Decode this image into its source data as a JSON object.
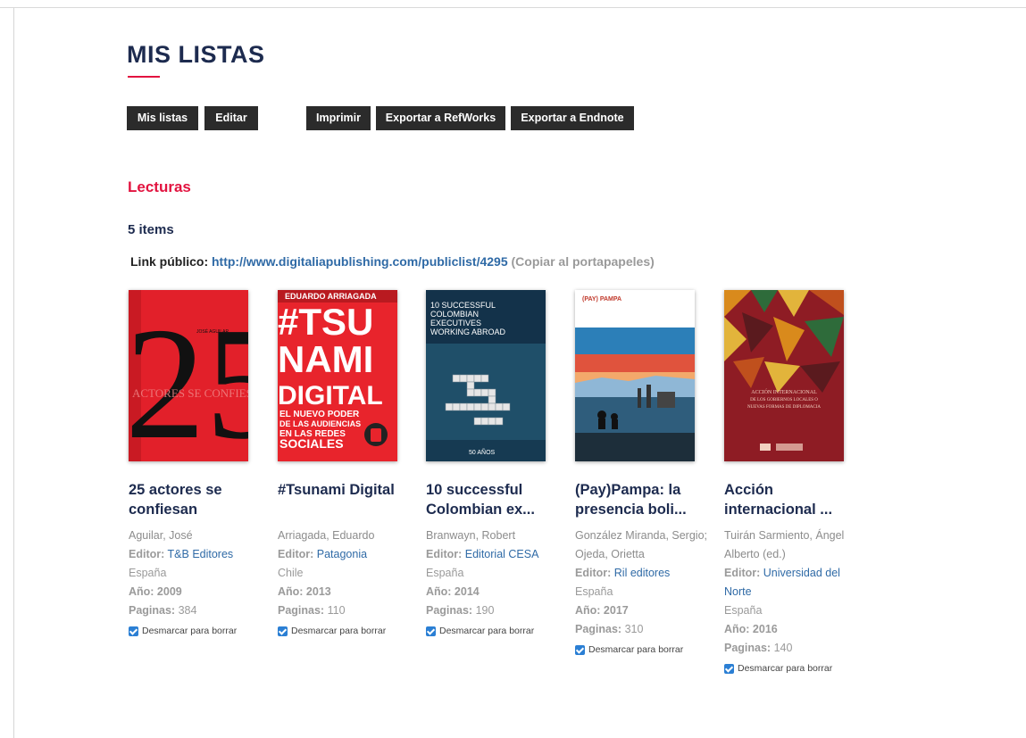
{
  "page": {
    "title": "MIS LISTAS",
    "list_name": "Lecturas",
    "item_count": "5 items",
    "public_link_label": "Link público:",
    "public_link_url": "http://www.digitaliapublishing.com/publiclist/4295",
    "copy_label": "(Copiar al portapapeles)"
  },
  "toolbar": {
    "mis_listas": "Mis listas",
    "editar": "Editar",
    "imprimir": "Imprimir",
    "refworks": "Exportar a RefWorks",
    "endnote": "Exportar a Endnote"
  },
  "labels": {
    "editor": "Editor:",
    "pages": "Paginas:",
    "uncheck": "Desmarcar para borrar"
  },
  "books": [
    {
      "title": "25 actores se confiesan",
      "author": "Aguilar, José",
      "editor": "T&B Editores",
      "country": "España",
      "year": "Año: 2009",
      "pages": "384",
      "cover": {
        "number": "25",
        "author_text": "JOSÉ AGUILAR",
        "subtitle": "ACTORES SE CONFIESAN"
      }
    },
    {
      "title": "#Tsunami Digital",
      "author": "Arriagada, Eduardo",
      "editor": "Patagonia",
      "country": "Chile",
      "year": "Año: 2013",
      "pages": "110",
      "cover": {
        "author_text": "EDUARDO ARRIAGADA",
        "line1": "#TSU",
        "line2": "NAMI",
        "line3": "DIGITAL",
        "sub1": "EL NUEVO PODER",
        "sub2": "DE LAS AUDIENCIAS",
        "sub3": "EN LAS REDES",
        "sub4": "SOCIALES"
      }
    },
    {
      "title": "10 successful Colombian ex...",
      "author": "Branwayn, Robert",
      "editor": "Editorial CESA",
      "country": "España",
      "year": "Año: 2014",
      "pages": "190",
      "cover": {
        "line1": "10 SUCCESSFUL",
        "line2": "COLOMBIAN",
        "line3": "EXECUTIVES",
        "line4": "WORKING ABROAD",
        "years": "50 AÑOS"
      }
    },
    {
      "title": "(Pay)Pampa: la presencia boli...",
      "author": "González Miranda, Sergio; Ojeda, Orietta",
      "editor": "Ril editores",
      "country": "España",
      "year": "Año: 2017",
      "pages": "310",
      "cover": {
        "head": "(PAY) PAMPA"
      }
    },
    {
      "title": "Acción internacional ...",
      "author": "Tuirán Sarmiento, Ángel Alberto (ed.)",
      "editor": "Universidad del Norte",
      "country": "España",
      "year": "Año: 2016",
      "pages": "140",
      "cover": {
        "line1": "ACCIÓN INTERNACIONAL",
        "line2": "DE LOS GOBIERNOS LOCALES O",
        "line3": "NUEVAS FORMAS DE DIPLOMACIA"
      }
    }
  ]
}
